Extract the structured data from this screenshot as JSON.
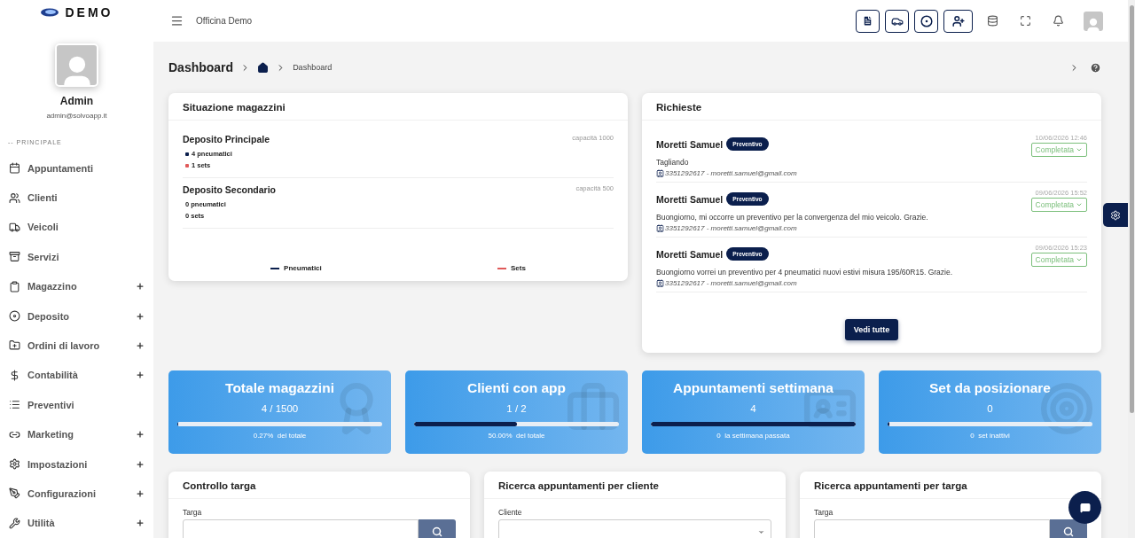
{
  "brand": {
    "name": "DEMO"
  },
  "user": {
    "name": "Admin",
    "email": "admin@solvoapp.it"
  },
  "sidebar": {
    "section": "-- PRINCIPALE",
    "items": [
      {
        "label": "Appuntamenti",
        "has_submenu": false
      },
      {
        "label": "Clienti",
        "has_submenu": false
      },
      {
        "label": "Veicoli",
        "has_submenu": false
      },
      {
        "label": "Servizi",
        "has_submenu": false
      },
      {
        "label": "Magazzino",
        "has_submenu": true
      },
      {
        "label": "Deposito",
        "has_submenu": true
      },
      {
        "label": "Ordini di lavoro",
        "has_submenu": true
      },
      {
        "label": "Contabilità",
        "has_submenu": true
      },
      {
        "label": "Preventivi",
        "has_submenu": false
      },
      {
        "label": "Marketing",
        "has_submenu": true
      },
      {
        "label": "Impostazioni",
        "has_submenu": true
      },
      {
        "label": "Configurazioni",
        "has_submenu": true
      },
      {
        "label": "Utilità",
        "has_submenu": true
      }
    ]
  },
  "topbar": {
    "title": "Officina Demo"
  },
  "breadcrumb": {
    "title": "Dashboard",
    "current": "Dashboard"
  },
  "warehouses": {
    "title": "Situazione magazzini",
    "items": [
      {
        "name": "Deposito Principale",
        "capacity": "capacità 1000",
        "lines": [
          {
            "text": "4 pneumatici",
            "color": "#0b1f4d"
          },
          {
            "text": "1 sets",
            "color": "#e05a5a"
          }
        ]
      },
      {
        "name": "Deposito Secondario",
        "capacity": "capacità 500",
        "lines": [
          {
            "text": "0 pneumatici"
          },
          {
            "text": "0 sets"
          }
        ]
      }
    ],
    "legend": [
      {
        "label": "Pneumatici",
        "color": "#0b1f4d"
      },
      {
        "label": "Sets",
        "color": "#e05a5a"
      }
    ]
  },
  "requests": {
    "title": "Richieste",
    "button": "Vedi tutte",
    "items": [
      {
        "name": "Moretti Samuel",
        "badge": "Preventivo",
        "date": "10/06/2026 12:46",
        "status": "Completata",
        "message": "Tagliando",
        "contact": "3351292617 - moretti.samuel@gmail.com"
      },
      {
        "name": "Moretti Samuel",
        "badge": "Preventivo",
        "date": "09/06/2026 15:52",
        "status": "Completata",
        "message": "Buongiorno, mi occorre un preventivo per la convergenza del mio veicolo. Grazie.",
        "contact": "3351292617 - moretti.samuel@gmail.com"
      },
      {
        "name": "Moretti Samuel",
        "badge": "Preventivo",
        "date": "09/06/2026 15:23",
        "status": "Completata",
        "message": "Buongiorno vorrei un preventivo per 4 pneumatici nuovi estivi misura 195/60R15. Grazie.",
        "contact": "3351292617 - moretti.samuel@gmail.com"
      }
    ]
  },
  "stats": [
    {
      "title": "Totale magazzini",
      "value": "4 / 1500",
      "level": 0.0027,
      "note_value": "0.27%",
      "note": "del totale"
    },
    {
      "title": "Clienti con app",
      "value": "1 / 2",
      "level": 0.5,
      "note_value": "50.00%",
      "note": "del totale"
    },
    {
      "title": "Appuntamenti settimana",
      "value": "4",
      "level": 1,
      "note_value": "0",
      "note": "la settimana passata"
    },
    {
      "title": "Set da posizionare",
      "value": "0",
      "level": 0.01,
      "note_value": "0",
      "note": "set inattivi"
    }
  ],
  "search_cards": [
    {
      "title": "Controllo targa",
      "label": "Targa",
      "kind": "search"
    },
    {
      "title": "Ricerca appuntamenti per cliente",
      "label": "Cliente",
      "kind": "select"
    },
    {
      "title": "Ricerca appuntamenti per targa",
      "label": "Targa",
      "kind": "search"
    }
  ]
}
